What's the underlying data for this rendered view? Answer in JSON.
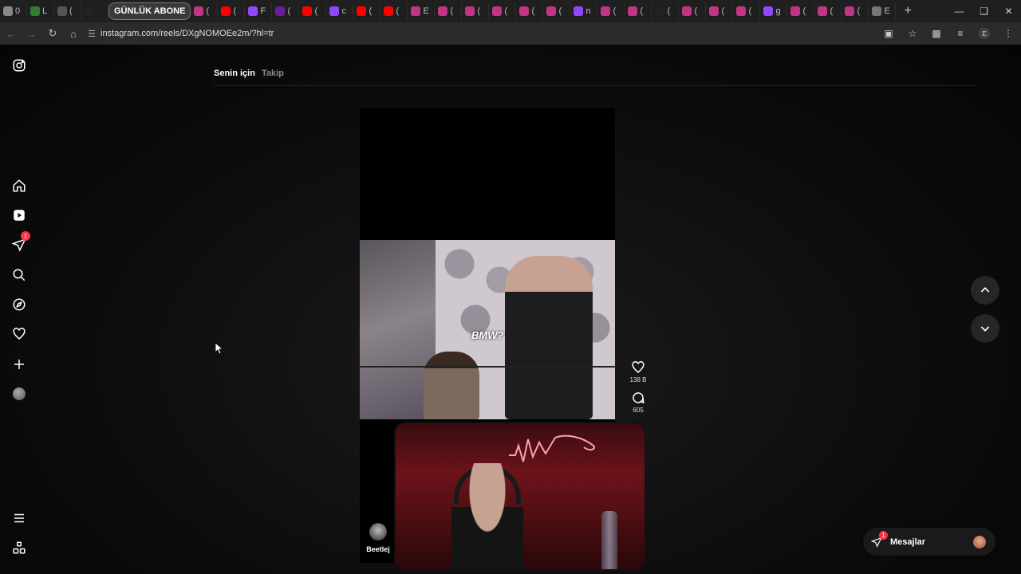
{
  "browser": {
    "active_tab_title": "GÜNLÜK ABONE",
    "tabs": [
      {
        "icon": "loading-icon",
        "label": "0",
        "color": "#888888"
      },
      {
        "icon": "tab-favicon",
        "label": "L",
        "color": "#2e7d32"
      },
      {
        "icon": "tab-favicon",
        "label": "(",
        "color": "#555555"
      },
      {
        "icon": "x-logo-icon",
        "label": "",
        "color": "#222222"
      },
      {
        "icon": "instagram-icon",
        "label": "(",
        "color": "#c13584"
      },
      {
        "icon": "youtube-icon",
        "label": "(",
        "color": "#ff0000"
      },
      {
        "icon": "twitch-icon",
        "label": "F",
        "color": "#9146ff"
      },
      {
        "icon": "tab-favicon",
        "label": "(",
        "color": "#6a1b9a"
      },
      {
        "icon": "youtube-icon",
        "label": "(",
        "color": "#ff0000"
      },
      {
        "icon": "kick-icon",
        "label": "c",
        "color": "#9146ff"
      },
      {
        "icon": "youtube-icon",
        "label": "(",
        "color": "#ff0000"
      },
      {
        "icon": "youtube-icon",
        "label": "(",
        "color": "#ff0000"
      },
      {
        "icon": "instagram-icon",
        "label": "E",
        "color": "#c13584"
      },
      {
        "icon": "instagram-icon",
        "label": "(",
        "color": "#c13584"
      },
      {
        "icon": "instagram-icon",
        "label": "(",
        "color": "#c13584"
      },
      {
        "icon": "instagram-icon",
        "label": "(",
        "color": "#c13584"
      },
      {
        "icon": "instagram-icon",
        "label": "(",
        "color": "#c13584"
      },
      {
        "icon": "instagram-icon",
        "label": "(",
        "color": "#c13584"
      },
      {
        "icon": "kick-icon",
        "label": "n",
        "color": "#9146ff"
      },
      {
        "icon": "instagram-icon",
        "label": "(",
        "color": "#c13584"
      },
      {
        "icon": "instagram-icon",
        "label": "(",
        "color": "#c13584"
      },
      {
        "icon": "x-logo-icon",
        "label": "(",
        "color": "#222222"
      },
      {
        "icon": "instagram-icon",
        "label": "(",
        "color": "#c13584"
      },
      {
        "icon": "instagram-icon",
        "label": "(",
        "color": "#c13584"
      },
      {
        "icon": "instagram-icon",
        "label": "(",
        "color": "#c13584"
      },
      {
        "icon": "kick-icon",
        "label": "g",
        "color": "#9146ff"
      },
      {
        "icon": "instagram-icon",
        "label": "(",
        "color": "#c13584"
      },
      {
        "icon": "instagram-icon",
        "label": "(",
        "color": "#c13584"
      },
      {
        "icon": "instagram-icon",
        "label": "(",
        "color": "#c13584"
      },
      {
        "icon": "globe-icon",
        "label": "E",
        "color": "#777777"
      }
    ],
    "new_tab_label": "+",
    "url": "instagram.com/reels/DXgNOMOEe2m/?hl=tr",
    "profile_initial": "E"
  },
  "sidebar": {
    "notifications_badge": "1"
  },
  "feed_tabs": {
    "for_you": "Senin için",
    "following": "Takip"
  },
  "reel": {
    "caption_overlay": "BMW?",
    "likes": "138 B",
    "comments": "605",
    "author": "Beetlej"
  },
  "messages": {
    "label": "Mesajlar",
    "badge": "1"
  },
  "colors": {
    "accent": "#ff3040",
    "background": "#000000"
  }
}
